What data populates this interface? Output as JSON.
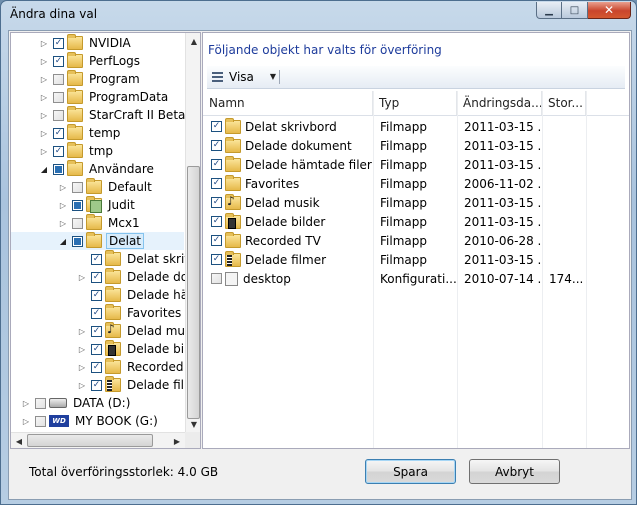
{
  "window": {
    "title": "Ändra dina val"
  },
  "tree": {
    "items": [
      {
        "label": "NVIDIA",
        "indent": 1,
        "expander": "collapsed",
        "check": "checked",
        "icon": "folder"
      },
      {
        "label": "PerfLogs",
        "indent": 1,
        "expander": "collapsed",
        "check": "checked",
        "icon": "folder"
      },
      {
        "label": "Program",
        "indent": 1,
        "expander": "collapsed",
        "check": "unchecked",
        "icon": "folder"
      },
      {
        "label": "ProgramData",
        "indent": 1,
        "expander": "collapsed",
        "check": "unchecked",
        "icon": "folder"
      },
      {
        "label": "StarCraft II Beta",
        "indent": 1,
        "expander": "collapsed",
        "check": "unchecked",
        "icon": "folder"
      },
      {
        "label": "temp",
        "indent": 1,
        "expander": "collapsed",
        "check": "checked",
        "icon": "folder"
      },
      {
        "label": "tmp",
        "indent": 1,
        "expander": "collapsed",
        "check": "checked",
        "icon": "folder"
      },
      {
        "label": "Användare",
        "indent": 1,
        "expander": "expanded",
        "check": "partial",
        "icon": "folder"
      },
      {
        "label": "Default",
        "indent": 2,
        "expander": "collapsed",
        "check": "unchecked",
        "icon": "folder"
      },
      {
        "label": "Judit",
        "indent": 2,
        "expander": "collapsed",
        "check": "partial",
        "icon": "user"
      },
      {
        "label": "Mcx1",
        "indent": 2,
        "expander": "collapsed",
        "check": "unchecked",
        "icon": "folder"
      },
      {
        "label": "Delat",
        "indent": 2,
        "expander": "expanded",
        "check": "partial",
        "icon": "folder",
        "selected": true
      },
      {
        "label": "Delat skriv",
        "indent": 3,
        "expander": "none",
        "check": "checked",
        "icon": "folder"
      },
      {
        "label": "Delade dok",
        "indent": 3,
        "expander": "collapsed",
        "check": "checked",
        "icon": "folder"
      },
      {
        "label": "Delade häm",
        "indent": 3,
        "expander": "none",
        "check": "checked",
        "icon": "folder"
      },
      {
        "label": "Favorites",
        "indent": 3,
        "expander": "none",
        "check": "checked",
        "icon": "folder"
      },
      {
        "label": "Delad mus",
        "indent": 3,
        "expander": "collapsed",
        "check": "checked",
        "icon": "music"
      },
      {
        "label": "Delade bild",
        "indent": 3,
        "expander": "collapsed",
        "check": "checked",
        "icon": "pictures"
      },
      {
        "label": "Recorded T",
        "indent": 3,
        "expander": "collapsed",
        "check": "checked",
        "icon": "folder"
      },
      {
        "label": "Delade filn",
        "indent": 3,
        "expander": "collapsed",
        "check": "checked",
        "icon": "film"
      },
      {
        "label": "DATA (D:)",
        "indent": 0,
        "expander": "collapsed",
        "check": "unchecked",
        "icon": "drive"
      },
      {
        "label": "MY BOOK (G:)",
        "indent": 0,
        "expander": "collapsed",
        "check": "unchecked",
        "icon": "wd"
      }
    ]
  },
  "right": {
    "heading": "Följande objekt har valts för överföring",
    "toolbar": {
      "view_label": "Visa"
    },
    "columns": [
      "Namn",
      "Typ",
      "Ändringsda...",
      "Stor..."
    ],
    "rows": [
      {
        "name": "Delat skrivbord",
        "type": "Filmapp",
        "date": "2011-03-15 ...",
        "size": "",
        "checked": true,
        "icon": "folder"
      },
      {
        "name": "Delade dokument",
        "type": "Filmapp",
        "date": "2011-03-15 ...",
        "size": "",
        "checked": true,
        "icon": "folder"
      },
      {
        "name": "Delade hämtade filer",
        "type": "Filmapp",
        "date": "2011-03-15 ...",
        "size": "",
        "checked": true,
        "icon": "folder"
      },
      {
        "name": "Favorites",
        "type": "Filmapp",
        "date": "2006-11-02 ...",
        "size": "",
        "checked": true,
        "icon": "folder"
      },
      {
        "name": "Delad musik",
        "type": "Filmapp",
        "date": "2011-03-15 ...",
        "size": "",
        "checked": true,
        "icon": "music"
      },
      {
        "name": "Delade bilder",
        "type": "Filmapp",
        "date": "2011-03-15 ...",
        "size": "",
        "checked": true,
        "icon": "pictures"
      },
      {
        "name": "Recorded TV",
        "type": "Filmapp",
        "date": "2010-06-28 ...",
        "size": "",
        "checked": true,
        "icon": "folder"
      },
      {
        "name": "Delade filmer",
        "type": "Filmapp",
        "date": "2011-03-15 ...",
        "size": "",
        "checked": true,
        "icon": "film"
      },
      {
        "name": "desktop",
        "type": "Konfigurati...",
        "date": "2010-07-14 ...",
        "size": "174...",
        "checked": false,
        "icon": "config"
      }
    ]
  },
  "footer": {
    "total_label": "Total överföringsstorlek: 4.0 GB",
    "save_label": "Spara",
    "cancel_label": "Avbryt"
  }
}
